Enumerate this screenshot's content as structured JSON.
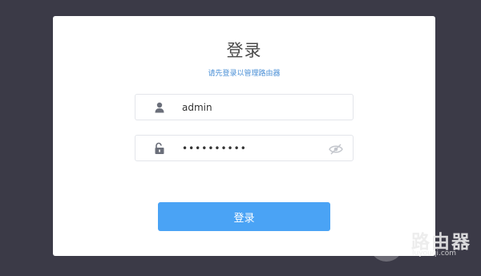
{
  "login": {
    "title": "登录",
    "subtitle": "请先登录以管理路由器",
    "username_value": "admin",
    "password_value": "••••••••••",
    "submit_label": "登录"
  },
  "watermark": {
    "brand": "路由器",
    "url": "luyouqi.com"
  },
  "icons": {
    "user": "user-icon",
    "lock": "unlock-icon",
    "eye": "eye-off-icon"
  },
  "colors": {
    "background": "#3b3a47",
    "card": "#ffffff",
    "accent": "#4aa3f5",
    "subtitle": "#4a8fd6"
  }
}
